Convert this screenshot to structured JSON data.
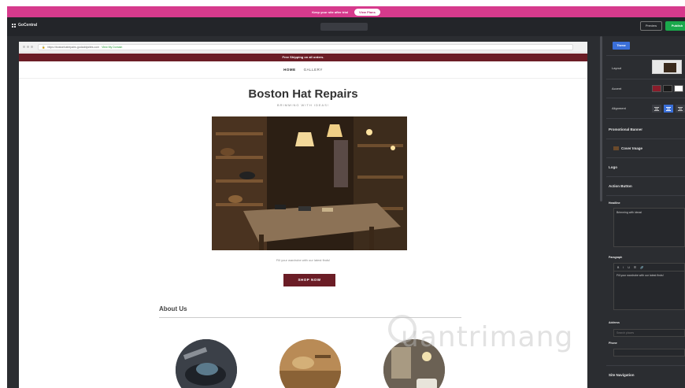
{
  "promo": {
    "text": "Keep your site after trial",
    "button": "View Plans"
  },
  "app": {
    "name": "GoCentral",
    "device_selector": "",
    "preview": "Preview",
    "publish": "Publish"
  },
  "browser": {
    "url": "https://bostonhatrepairs.godaddysites.com",
    "url_link": "View My Domain"
  },
  "site": {
    "shipping_banner": "Free Shipping on all orders.",
    "nav": [
      "HOME",
      "GALLERY"
    ],
    "title": "Boston Hat Repairs",
    "tagline": "BRIMMING WITH IDEAS!",
    "hero_text": "Fill your wardrobe with our latest finds!",
    "cta": "SHOP NOW",
    "about_heading": "About Us"
  },
  "panel": {
    "theme_tab": "Theme",
    "layout_label": "Layout",
    "accent_label": "Accent",
    "alignment_label": "Alignment",
    "accent_colors": [
      "#8a1c2a",
      "#1a1a1a",
      "#ffffff"
    ],
    "sections": {
      "promo_banner": "Promotional Banner",
      "cover_image": "Cover Image",
      "logo": "Logo",
      "action_button": "Action Button",
      "headline": "Headline",
      "paragraph": "Paragraph",
      "address": "Address",
      "phone": "Phone",
      "site_nav": "Site Navigation"
    },
    "headline_value": "Brimming with ideas!",
    "paragraph_value": "Fill your wardrobe with our latest finds!",
    "format_buttons": [
      "B",
      "I",
      "U",
      "☰",
      "🔗"
    ],
    "address_placeholder": "Search places"
  },
  "watermark": "uantrimang"
}
